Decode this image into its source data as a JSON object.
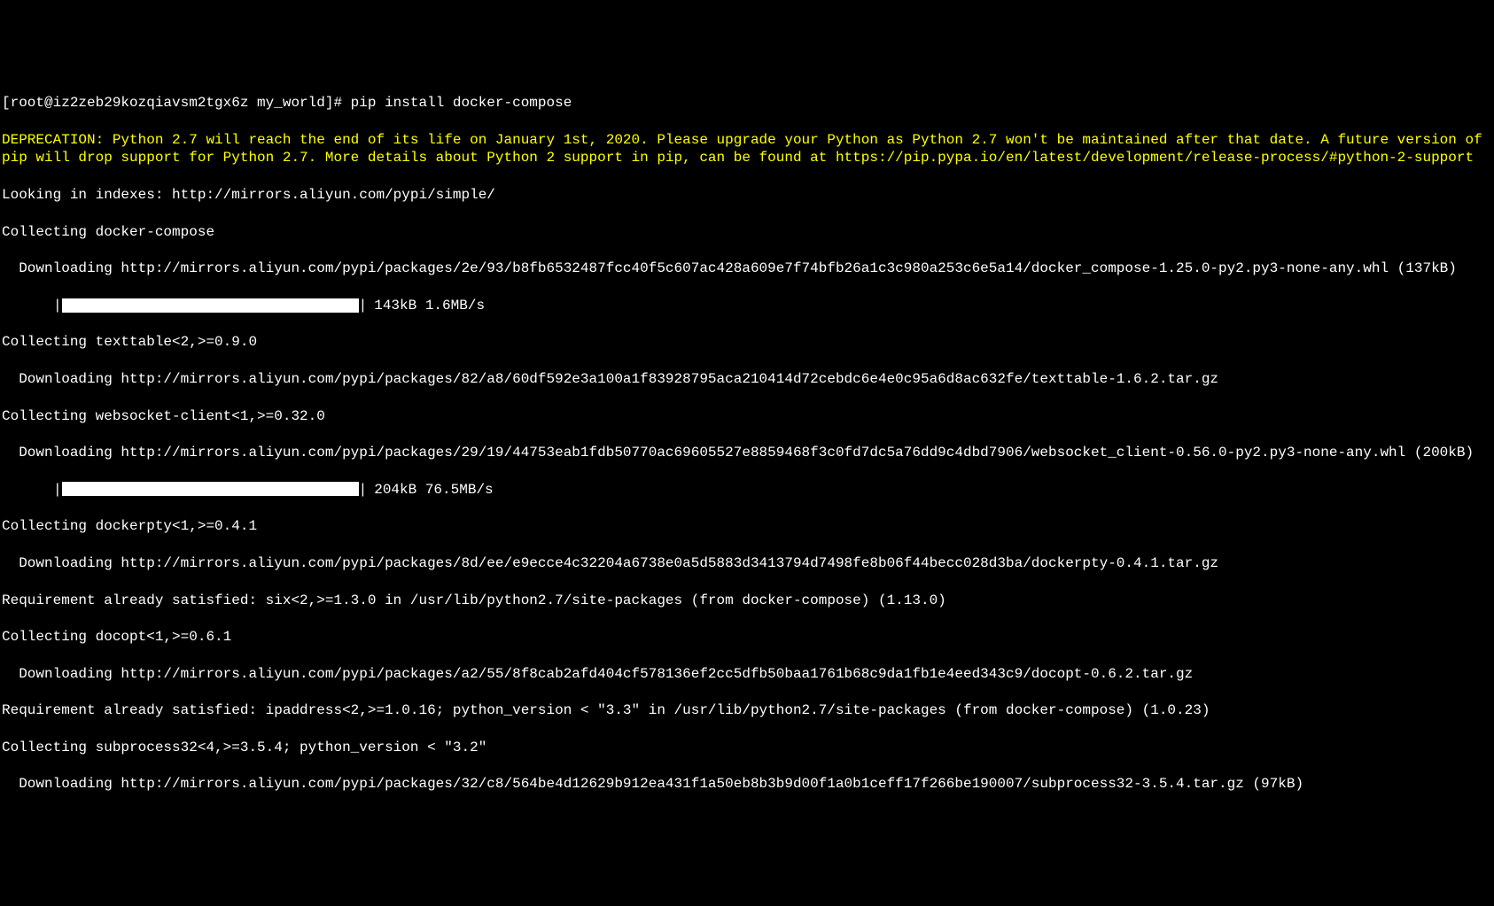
{
  "prompt": "[root@iz2zeb29kozqiavsm2tgx6z my_world]# ",
  "command": "pip install docker-compose",
  "deprecation": "DEPRECATION: Python 2.7 will reach the end of its life on January 1st, 2020. Please upgrade your Python as Python 2.7 won't be maintained after that date. A future version of pip will drop support for Python 2.7. More details about Python 2 support in pip, can be found at https://pip.pypa.io/en/latest/development/release-process/#python-2-support",
  "lines": {
    "looking": "Looking in indexes: http://mirrors.aliyun.com/pypi/simple/",
    "collecting_dc": "Collecting docker-compose",
    "dl_dc": "  Downloading http://mirrors.aliyun.com/pypi/packages/2e/93/b8fb6532487fcc40f5c607ac428a609e7f74bfb26a1c3c980a253c6e5a14/docker_compose-1.25.0-py2.py3-none-any.whl (137kB)",
    "progress1_stats": "143kB 1.6MB/s",
    "collecting_tt": "Collecting texttable<2,>=0.9.0",
    "dl_tt": "  Downloading http://mirrors.aliyun.com/pypi/packages/82/a8/60df592e3a100a1f83928795aca210414d72cebdc6e4e0c95a6d8ac632fe/texttable-1.6.2.tar.gz",
    "collecting_ws": "Collecting websocket-client<1,>=0.32.0",
    "dl_ws": "  Downloading http://mirrors.aliyun.com/pypi/packages/29/19/44753eab1fdb50770ac69605527e8859468f3c0fd7dc5a76dd9c4dbd7906/websocket_client-0.56.0-py2.py3-none-any.whl (200kB)",
    "progress2_stats": "204kB 76.5MB/s",
    "collecting_dp": "Collecting dockerpty<1,>=0.4.1",
    "dl_dp": "  Downloading http://mirrors.aliyun.com/pypi/packages/8d/ee/e9ecce4c32204a6738e0a5d5883d3413794d7498fe8b06f44becc028d3ba/dockerpty-0.4.1.tar.gz",
    "req_six": "Requirement already satisfied: six<2,>=1.3.0 in /usr/lib/python2.7/site-packages (from docker-compose) (1.13.0)",
    "collecting_do": "Collecting docopt<1,>=0.6.1",
    "dl_do": "  Downloading http://mirrors.aliyun.com/pypi/packages/a2/55/8f8cab2afd404cf578136ef2cc5dfb50baa1761b68c9da1fb1e4eed343c9/docopt-0.6.2.tar.gz",
    "req_ip": "Requirement already satisfied: ipaddress<2,>=1.0.16; python_version < \"3.3\" in /usr/lib/python2.7/site-packages (from docker-compose) (1.0.23)",
    "collecting_sp": "Collecting subprocess32<4,>=3.5.4; python_version < \"3.2\"",
    "dl_sp": "  Downloading http://mirrors.aliyun.com/pypi/packages/32/c8/564be4d12629b912ea431f1a50eb8b3b9d00f1a0b1ceff17f266be190007/subprocess32-3.5.4.tar.gz (97kB)"
  }
}
